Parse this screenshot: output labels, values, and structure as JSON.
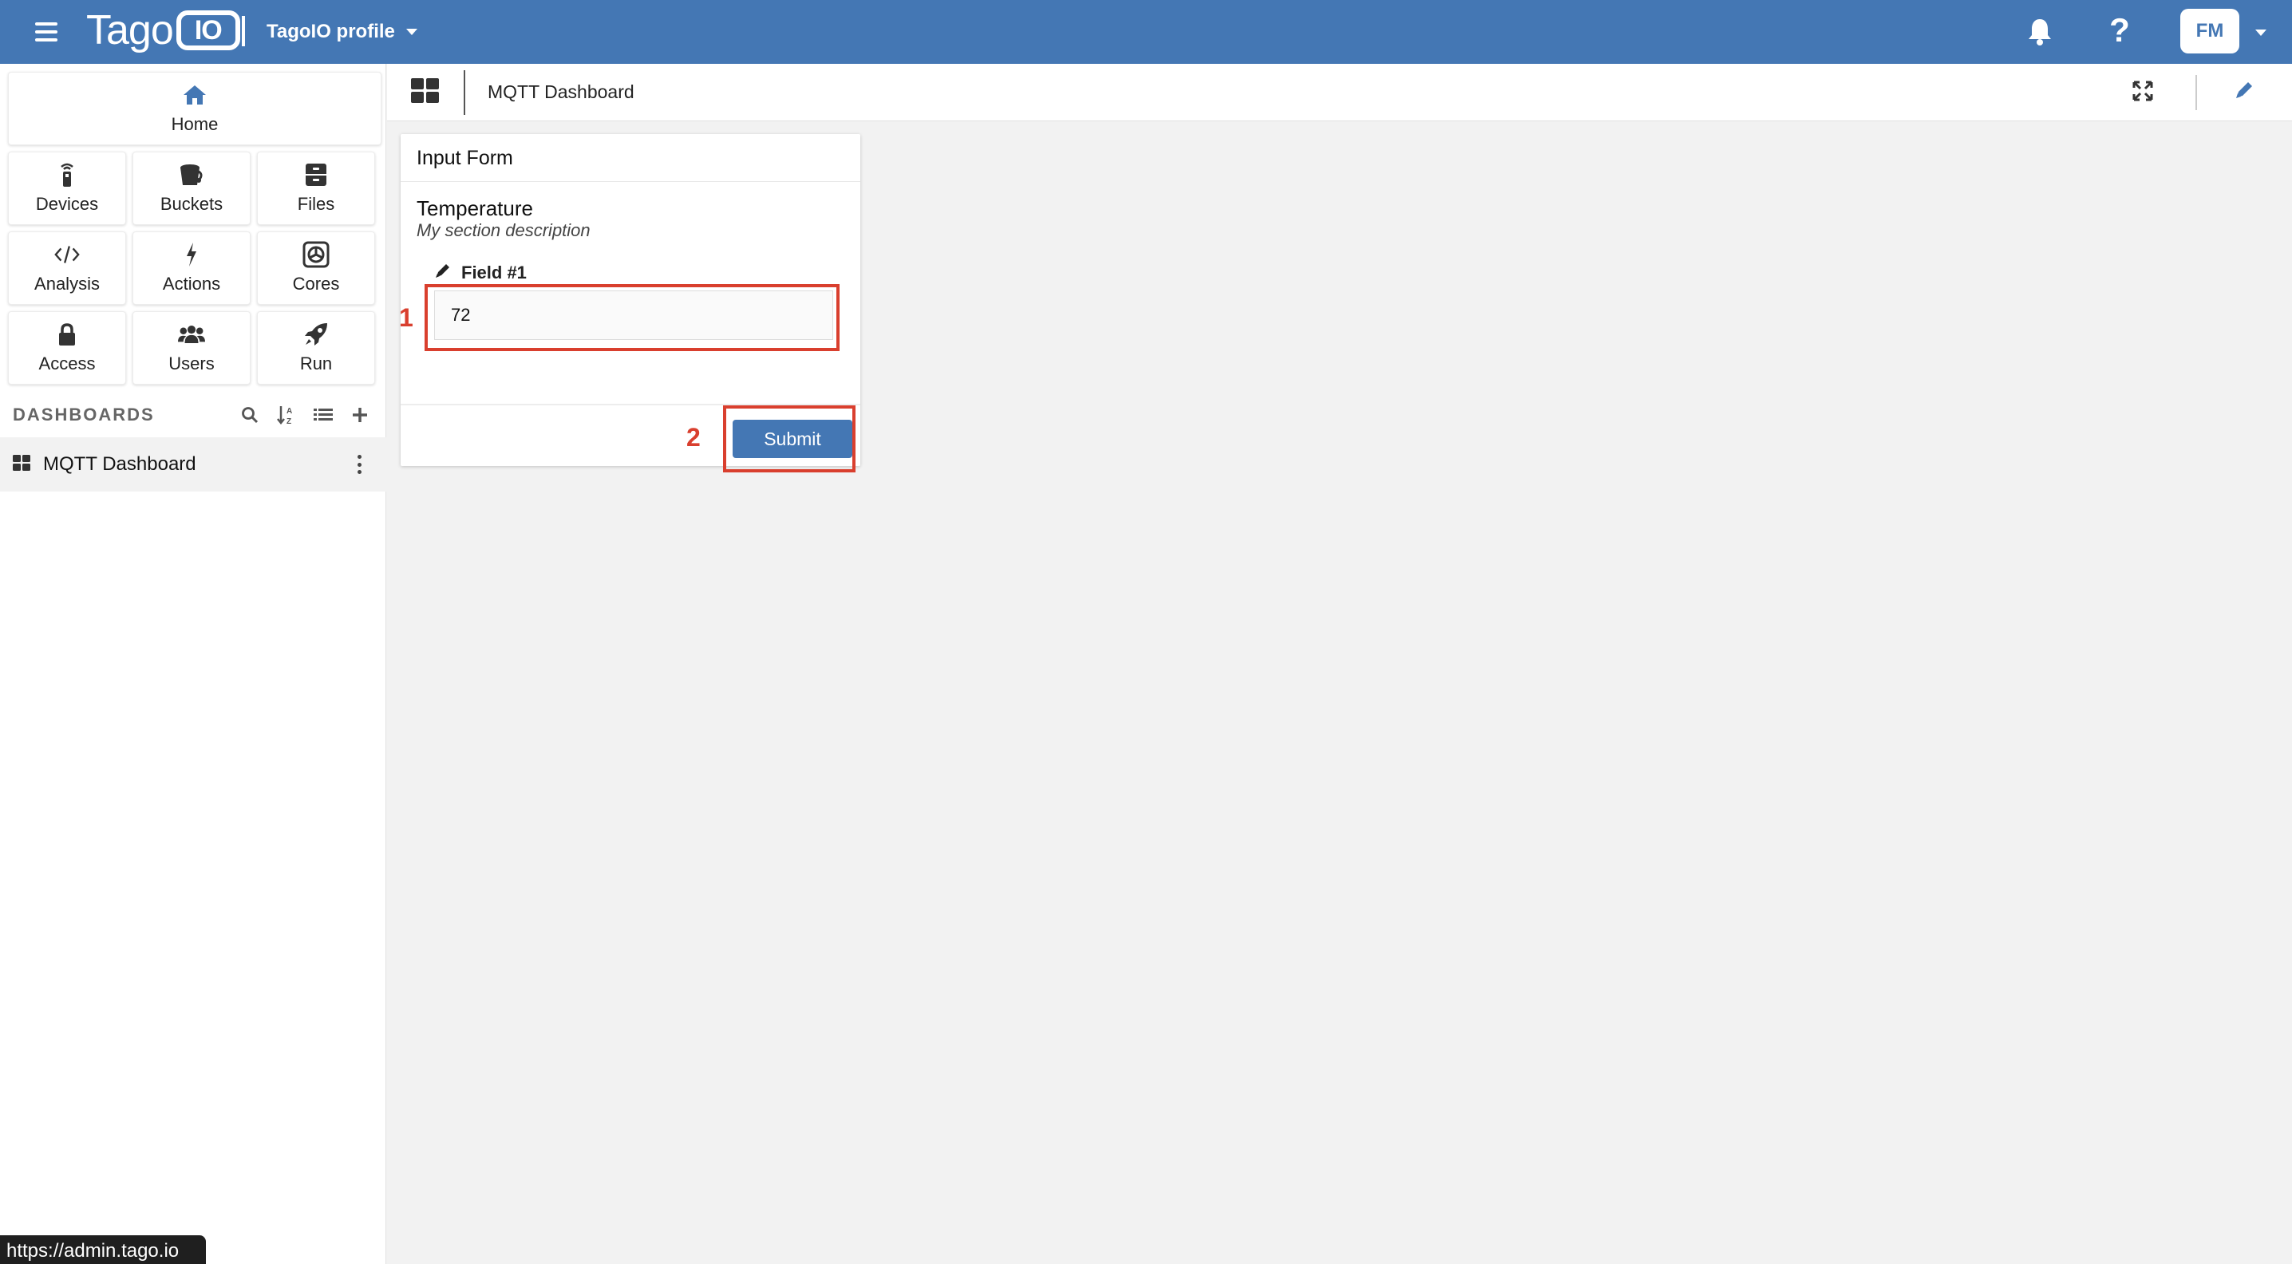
{
  "topbar": {
    "logo_text": "Tago",
    "logo_badge": "IO",
    "profile_label": "TagoIO profile",
    "avatar_initials": "FM",
    "help_glyph": "?",
    "icons": {
      "menu": "hamburger-icon",
      "notifications": "bell-icon",
      "help": "question-icon",
      "avatar_menu": "chevron-down-icon"
    },
    "background_color": "#4477b4"
  },
  "sidebar": {
    "home_label": "Home",
    "nav_items": [
      {
        "label": "Devices",
        "icon": "device-icon"
      },
      {
        "label": "Buckets",
        "icon": "bucket-icon"
      },
      {
        "label": "Files",
        "icon": "files-icon"
      },
      {
        "label": "Analysis",
        "icon": "code-icon"
      },
      {
        "label": "Actions",
        "icon": "bolt-icon"
      },
      {
        "label": "Cores",
        "icon": "core-icon"
      },
      {
        "label": "Access",
        "icon": "lock-icon"
      },
      {
        "label": "Users",
        "icon": "users-icon"
      },
      {
        "label": "Run",
        "icon": "rocket-icon"
      }
    ],
    "dashboards_header": "DASHBOARDS",
    "dashboards": [
      {
        "label": "MQTT Dashboard"
      }
    ]
  },
  "content": {
    "dashboard_title": "MQTT Dashboard"
  },
  "widget": {
    "title": "Input Form",
    "section_title": "Temperature",
    "section_description": "My section description",
    "field_label": "Field #1",
    "field_value": "72",
    "submit_label": "Submit"
  },
  "annotations": {
    "step1": "1",
    "step2": "2",
    "color": "#d93f2e"
  },
  "status_bar": {
    "url": "https://admin.tago.io"
  }
}
